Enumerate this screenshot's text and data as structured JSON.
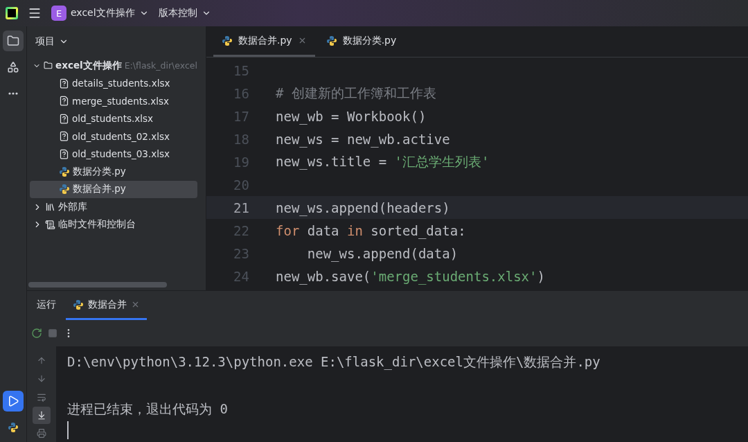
{
  "title_bar": {
    "project_badge": "E",
    "project_name": "excel文件操作",
    "vcs": "版本控制"
  },
  "tool_strip": {
    "items": [
      {
        "kind": "folder",
        "selected": true
      },
      {
        "kind": "structure",
        "selected": false
      },
      {
        "kind": "more",
        "selected": false
      }
    ],
    "bottom_items": [
      {
        "kind": "run",
        "selected": true
      },
      {
        "kind": "python",
        "selected": false
      }
    ]
  },
  "project_panel": {
    "title": "项目",
    "tree": [
      {
        "label": "excel文件操作",
        "path": "E:\\flask_dir\\excel",
        "kind": "folder",
        "expanded": true,
        "selected": false,
        "children": [
          {
            "label": "details_students.xlsx",
            "kind": "unknown",
            "selected": false
          },
          {
            "label": "merge_students.xlsx",
            "kind": "unknown",
            "selected": false
          },
          {
            "label": "old_students.xlsx",
            "kind": "unknown",
            "selected": false
          },
          {
            "label": "old_students_02.xlsx",
            "kind": "unknown",
            "selected": false
          },
          {
            "label": "old_students_03.xlsx",
            "kind": "unknown",
            "selected": false
          },
          {
            "label": "数据分类.py",
            "kind": "python",
            "selected": false
          },
          {
            "label": "数据合并.py",
            "kind": "python",
            "selected": true
          }
        ]
      },
      {
        "label": "外部库",
        "kind": "library",
        "expanded": false,
        "selected": false
      },
      {
        "label": "临时文件和控制台",
        "kind": "scratch",
        "expanded": false,
        "selected": false
      }
    ]
  },
  "editor": {
    "tabs": [
      {
        "label": "数据合并.py",
        "selected": true,
        "closable": true
      },
      {
        "label": "数据分类.py",
        "selected": false,
        "closable": false
      }
    ],
    "lines": [
      {
        "number": "15",
        "current": false
      },
      {
        "number": "16",
        "current": false,
        "tokens": [
          {
            "kind": "comment",
            "text": "# 创建新的工作簿和工作表"
          }
        ]
      },
      {
        "number": "17",
        "current": false,
        "tokens": [
          {
            "kind": "plain",
            "text": "new_wb = Workbook()"
          }
        ]
      },
      {
        "number": "18",
        "current": false,
        "tokens": [
          {
            "kind": "plain",
            "text": "new_ws = new_wb.active"
          }
        ]
      },
      {
        "number": "19",
        "current": false,
        "tokens": [
          {
            "kind": "plain",
            "text": "new_ws.title = "
          },
          {
            "kind": "string",
            "text": "'汇总学生列表'"
          }
        ]
      },
      {
        "number": "20",
        "current": false
      },
      {
        "number": "21",
        "current": true,
        "tokens": [
          {
            "kind": "plain",
            "text": "new_ws.append(headers)"
          }
        ]
      },
      {
        "number": "22",
        "current": false,
        "tokens": [
          {
            "kind": "keyword",
            "text": "for"
          },
          {
            "kind": "plain",
            "text": " data "
          },
          {
            "kind": "keyword",
            "text": "in"
          },
          {
            "kind": "plain",
            "text": " sorted_data:"
          }
        ]
      },
      {
        "number": "23",
        "current": false,
        "tokens": [
          {
            "kind": "plain",
            "text": "    new_ws.append(data)"
          }
        ]
      },
      {
        "number": "24",
        "current": false,
        "tokens": [
          {
            "kind": "plain",
            "text": "new_wb.save("
          },
          {
            "kind": "string",
            "text": "'merge_students.xlsx'"
          },
          {
            "kind": "plain",
            "text": ")"
          }
        ]
      }
    ]
  },
  "run_panel": {
    "tabs": [
      {
        "label": "运行",
        "kind": "title",
        "selected": false
      },
      {
        "label": "数据合并",
        "kind": "config",
        "selected": true
      }
    ],
    "console": {
      "command": "D:\\env\\python\\3.12.3\\python.exe E:\\flask_dir\\excel文件操作\\数据合并.py",
      "exit_message": "进程已结束，退出代码为 0"
    },
    "gutter": [
      {
        "kind": "up",
        "selected": false
      },
      {
        "kind": "down",
        "selected": false
      },
      {
        "kind": "wrap",
        "selected": false
      },
      {
        "kind": "scroll-end",
        "selected": true
      },
      {
        "kind": "print",
        "selected": false
      }
    ]
  }
}
